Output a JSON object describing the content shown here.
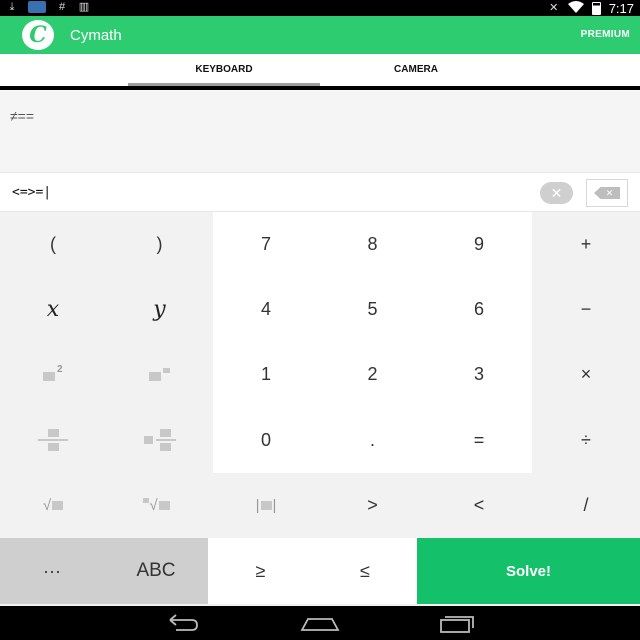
{
  "status_bar": {
    "time": "7:17",
    "left_icons": [
      "download-icon",
      "image-notification-icon",
      "hash-icon",
      "barcode-icon"
    ],
    "right_icons": [
      "muted-icon",
      "wifi-icon",
      "battery-icon"
    ]
  },
  "app_bar": {
    "logo_letter": "C",
    "title": "Cymath",
    "premium_label": "PREMIUM",
    "background_color": "#2ecc71"
  },
  "tabs": [
    {
      "label": "KEYBOARD",
      "selected": true
    },
    {
      "label": "CAMERA",
      "selected": false
    }
  ],
  "display": {
    "expression": "≠=="
  },
  "input": {
    "value": "<=>=|",
    "clear_icon": "clear-circle-icon",
    "backspace_icon": "backspace-icon"
  },
  "keypad": {
    "row1": [
      "(",
      ")",
      "7",
      "8",
      "9",
      "+"
    ],
    "row2": [
      "x",
      "y",
      "4",
      "5",
      "6",
      "−"
    ],
    "row3": [
      "square-power-icon",
      "box-power-icon",
      "1",
      "2",
      "3",
      "×"
    ],
    "row4": [
      "fraction-icon",
      "mixed-fraction-icon",
      "0",
      ".",
      "=",
      "÷"
    ],
    "row5": [
      "sqrt-icon",
      "nth-root-icon",
      "abs-icon",
      ">",
      "<",
      "/"
    ]
  },
  "bottom_row": {
    "more": "···",
    "abc": "ABC",
    "ge": "≥",
    "le": "≤",
    "solve": "Solve!",
    "solve_color": "#14c06a"
  },
  "nav_bar": [
    "back-icon",
    "home-icon",
    "recents-icon"
  ]
}
